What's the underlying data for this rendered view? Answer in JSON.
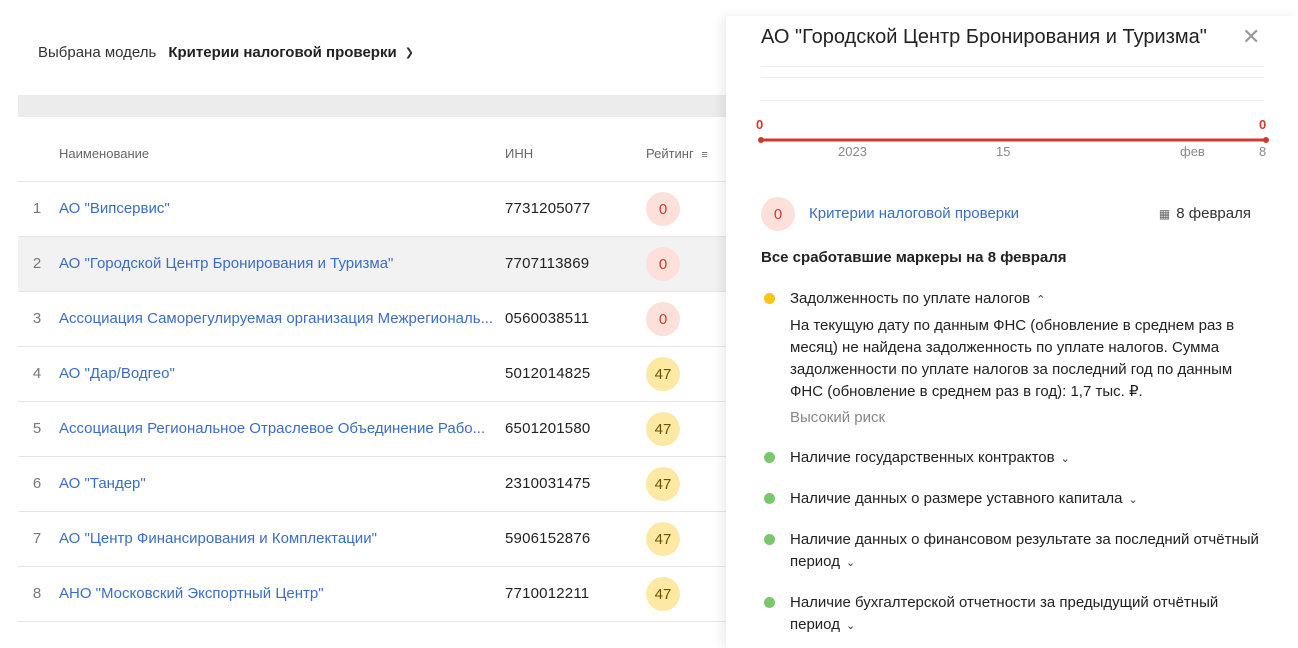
{
  "model": {
    "label": "Выбрана модель",
    "value": "Критерии налоговой проверки"
  },
  "table": {
    "headers": {
      "name": "Наименование",
      "inn": "ИНН",
      "rating": "Рейтинг"
    },
    "rows": [
      {
        "num": "1",
        "name": "АО \"Випсервис\"",
        "inn": "7731205077",
        "rating": "0",
        "level": "red"
      },
      {
        "num": "2",
        "name": "АО \"Городской Центр Бронирования и Туризма\"",
        "inn": "7707113869",
        "rating": "0",
        "level": "red",
        "selected": true
      },
      {
        "num": "3",
        "name": "Ассоциация Саморегулируемая организация Межрегиональ...",
        "inn": "0560038511",
        "rating": "0",
        "level": "red"
      },
      {
        "num": "4",
        "name": "АО \"Дар/Водгео\"",
        "inn": "5012014825",
        "rating": "47",
        "level": "yellow"
      },
      {
        "num": "5",
        "name": "Ассоциация Региональное Отраслевое Объединение Рабо...",
        "inn": "6501201580",
        "rating": "47",
        "level": "yellow"
      },
      {
        "num": "6",
        "name": "АО \"Тандер\"",
        "inn": "2310031475",
        "rating": "47",
        "level": "yellow"
      },
      {
        "num": "7",
        "name": "АО \"Центр Финансирования и Комплектации\"",
        "inn": "5906152876",
        "rating": "47",
        "level": "yellow"
      },
      {
        "num": "8",
        "name": "АНО \"Московский Экспортный Центр\"",
        "inn": "7710012211",
        "rating": "47",
        "level": "yellow"
      }
    ]
  },
  "drawer": {
    "title": "АО \"Городской Центр Бронирования и Туризма\"",
    "chart": {
      "start_value": "0",
      "end_value": "0",
      "ticks": [
        "2023",
        "15",
        "фев",
        "8"
      ]
    },
    "criteria": {
      "score": "0",
      "link": "Критерии налоговой проверки",
      "date": "8 февраля"
    },
    "all_markers_heading": "Все сработавшие маркеры на 8 февраля",
    "markers": [
      {
        "title": "Задолженность по уплате налогов",
        "color": "yellow",
        "expanded": true,
        "desc": "На текущую дату по данным ФНС (обновление в среднем раз в месяц) не найдена задолженность по уплате налогов. Сумма задолженности по уплате налогов за последний год по данным ФНС (обновление в среднем раз в год): 1,7 тыс. ₽.",
        "risk": "Высокий риск"
      },
      {
        "title": "Наличие государственных контрактов",
        "color": "green"
      },
      {
        "title": "Наличие данных о размере уставного капитала",
        "color": "green"
      },
      {
        "title": "Наличие данных о финансовом результате за последний отчётный период",
        "color": "green"
      },
      {
        "title": "Наличие бухгалтерской отчетности за предыдущий отчётный период",
        "color": "green"
      }
    ]
  },
  "colors": {
    "link": "#3b6dc4",
    "danger": "#d03a2c",
    "warn": "#f5c518",
    "ok": "#7bc86c"
  }
}
